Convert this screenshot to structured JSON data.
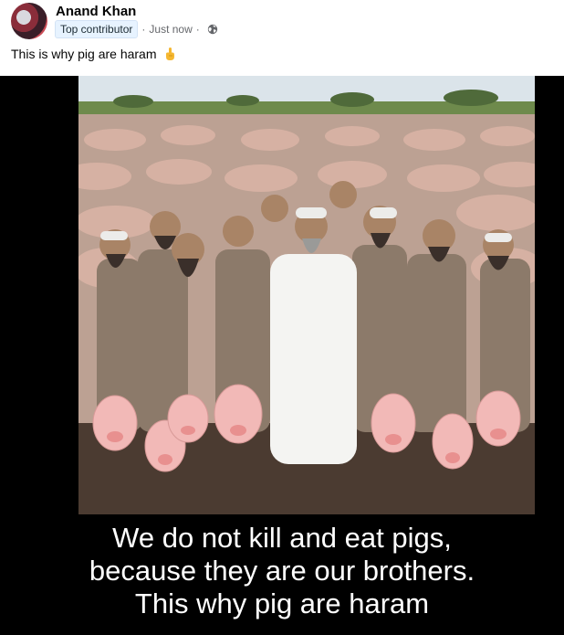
{
  "post": {
    "author_name": "Anand Khan",
    "badge": "Top contributor",
    "separator": "·",
    "timestamp": "Just now",
    "caption": "This is why pig are haram",
    "caption_emoji_icon": "hand-pointing-up-icon",
    "privacy_icon": "globe-icon"
  },
  "media": {
    "overlay_lines": [
      "We do not kill and eat pigs,",
      "because they are our brothers.",
      "This why pig are haram"
    ]
  }
}
